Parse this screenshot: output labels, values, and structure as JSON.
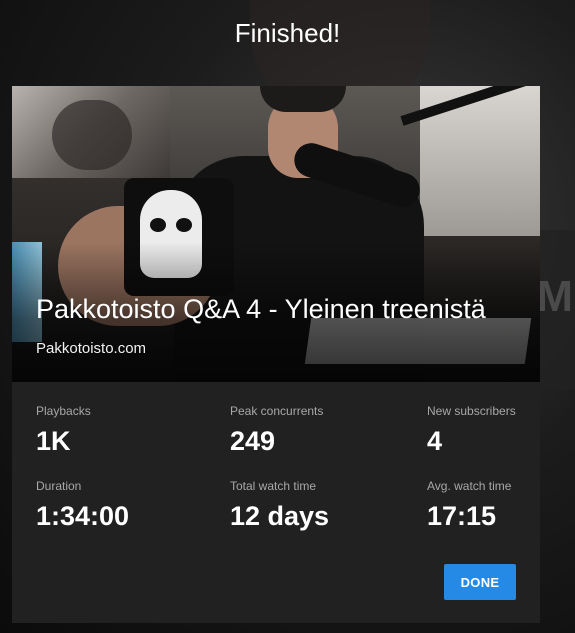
{
  "dialog": {
    "heading": "Finished!"
  },
  "video": {
    "title": "Pakkotoisto Q&A 4 - Yleinen treenistä",
    "channel": "Pakkotoisto.com"
  },
  "stats": [
    {
      "label": "Playbacks",
      "value": "1K"
    },
    {
      "label": "Peak concurrents",
      "value": "249"
    },
    {
      "label": "New subscribers",
      "value": "4"
    },
    {
      "label": "Duration",
      "value": "1:34:00"
    },
    {
      "label": "Total watch time",
      "value": "12 days"
    },
    {
      "label": "Avg. watch time",
      "value": "17:15"
    }
  ],
  "actions": {
    "done_label": "DONE"
  },
  "colors": {
    "accent": "#2589e6",
    "card_background": "#212121"
  }
}
